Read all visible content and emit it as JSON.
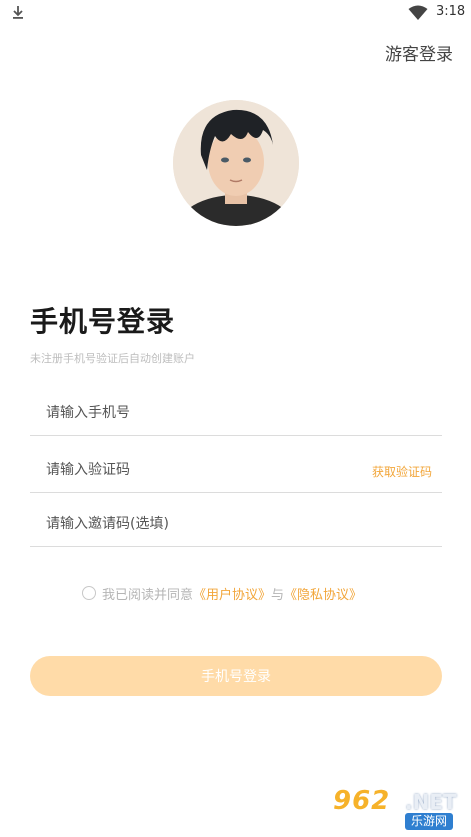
{
  "status_bar": {
    "time": "3:18"
  },
  "header": {
    "guest_login": "游客登录"
  },
  "login": {
    "title": "手机号登录",
    "subtitle": "未注册手机号验证后自动创建账户",
    "phone_placeholder": "请输入手机号",
    "code_placeholder": "请输入验证码",
    "get_code": "获取验证码",
    "invite_placeholder": "请输入邀请码(选填)",
    "agreement_prefix": "我已阅读并同意",
    "user_agreement": "《用户协议》",
    "and": "与",
    "privacy_agreement": "《隐私协议》",
    "submit": "手机号登录"
  },
  "colors": {
    "accent": "#f2a63a",
    "button_bg": "#ffdba8"
  },
  "watermark": {
    "number": "962",
    "net": ".NET",
    "site": "乐游网"
  },
  "icons": [
    "download-icon",
    "wifi-icon",
    "avatar"
  ]
}
